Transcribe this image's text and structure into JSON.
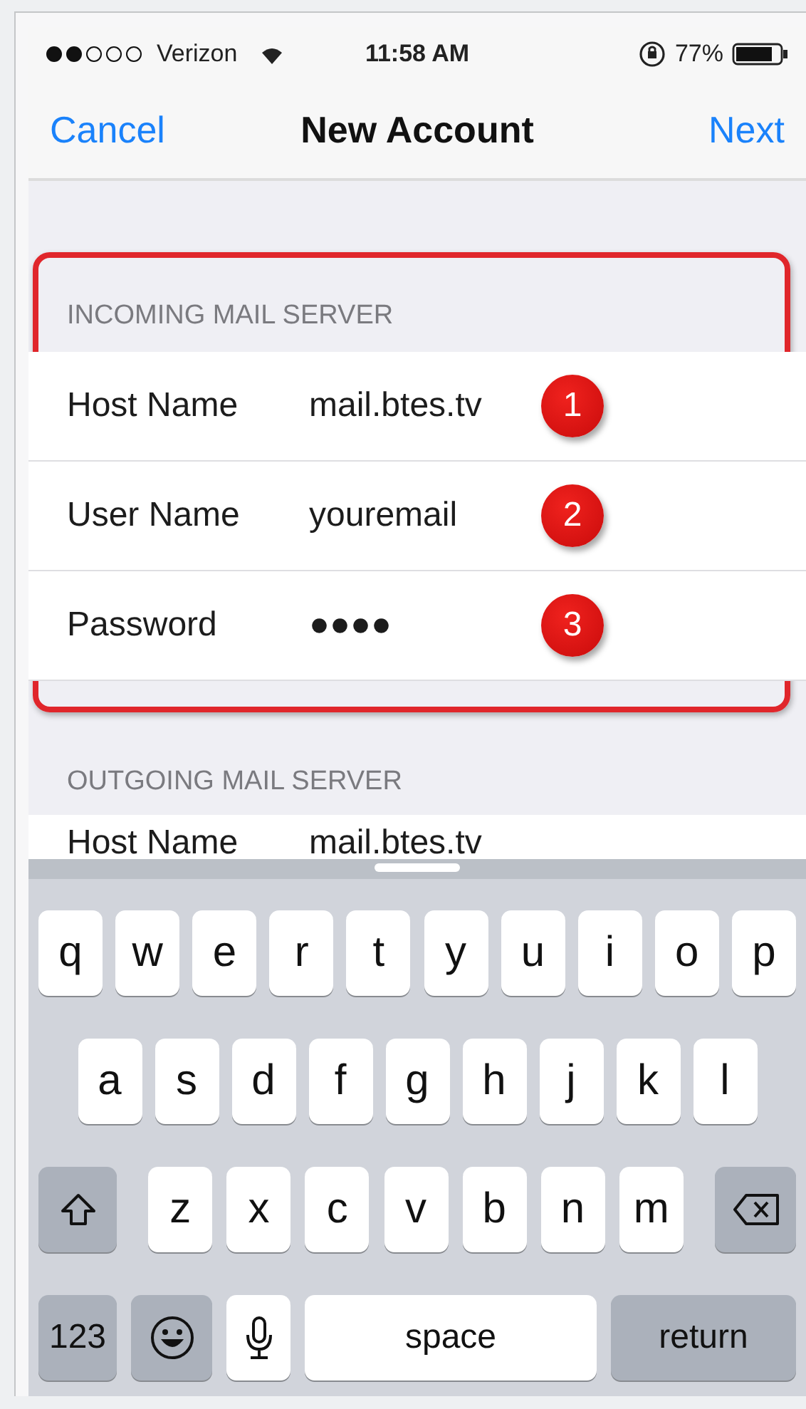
{
  "status_bar": {
    "carrier": "Verizon",
    "time": "11:58 AM",
    "battery": "77%"
  },
  "nav": {
    "left": "Cancel",
    "title": "New Account",
    "right": "Next"
  },
  "sections": [
    {
      "header": "INCOMING MAIL SERVER",
      "highlighted": true,
      "rows": [
        {
          "label": "Host Name",
          "value": "mail.btes.tv",
          "badge": "1"
        },
        {
          "label": "User Name",
          "value": "youremail",
          "badge": "2"
        },
        {
          "label": "Password",
          "value": "●●●●",
          "badge": "3"
        }
      ]
    },
    {
      "header": "OUTGOING MAIL SERVER",
      "highlighted": false,
      "rows": [
        {
          "label": "Host Name",
          "value": "mail.btes.tv"
        }
      ]
    }
  ],
  "keyboard": {
    "rows": [
      {
        "keys": [
          {
            "kind": "letter",
            "label": "q"
          },
          {
            "kind": "letter",
            "label": "w"
          },
          {
            "kind": "letter",
            "label": "e"
          },
          {
            "kind": "letter",
            "label": "r"
          },
          {
            "kind": "letter",
            "label": "t"
          },
          {
            "kind": "letter",
            "label": "y"
          },
          {
            "kind": "letter",
            "label": "u"
          },
          {
            "kind": "letter",
            "label": "i"
          },
          {
            "kind": "letter",
            "label": "o"
          },
          {
            "kind": "letter",
            "label": "p"
          }
        ]
      },
      {
        "keys": [
          {
            "kind": "letter",
            "label": "a"
          },
          {
            "kind": "letter",
            "label": "s"
          },
          {
            "kind": "letter",
            "label": "d"
          },
          {
            "kind": "letter",
            "label": "f"
          },
          {
            "kind": "letter",
            "label": "g"
          },
          {
            "kind": "letter",
            "label": "h"
          },
          {
            "kind": "letter",
            "label": "j"
          },
          {
            "kind": "letter",
            "label": "k"
          },
          {
            "kind": "letter",
            "label": "l"
          }
        ]
      },
      {
        "keys": [
          {
            "kind": "shift"
          },
          {
            "kind": "letter",
            "label": "z"
          },
          {
            "kind": "letter",
            "label": "x"
          },
          {
            "kind": "letter",
            "label": "c"
          },
          {
            "kind": "letter",
            "label": "v"
          },
          {
            "kind": "letter",
            "label": "b"
          },
          {
            "kind": "letter",
            "label": "n"
          },
          {
            "kind": "letter",
            "label": "m"
          },
          {
            "kind": "delete"
          }
        ]
      },
      {
        "keys": [
          {
            "kind": "mode",
            "label": "123"
          },
          {
            "kind": "emoji"
          },
          {
            "kind": "mic"
          },
          {
            "kind": "space",
            "label": "space"
          },
          {
            "kind": "return",
            "label": "return"
          }
        ]
      }
    ]
  }
}
